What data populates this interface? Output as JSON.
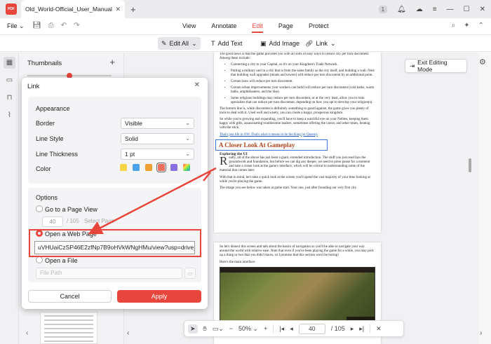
{
  "titlebar": {
    "logo_text": "PDF",
    "tab_name": "Old_World-Official_User_Manual",
    "notification_count": "1"
  },
  "menu": {
    "file": "File",
    "tabs": [
      "View",
      "Annotate",
      "Edit",
      "Page",
      "Protect"
    ],
    "active_tab": "Edit"
  },
  "toolbar": {
    "edit_all": "Edit All",
    "add_text": "Add Text",
    "add_image": "Add Image",
    "link": "Link"
  },
  "thumbnails": {
    "title": "Thumbnails",
    "zoom_fraction": 0.5
  },
  "exit_editing": "Exit Editing Mode",
  "dialog": {
    "title": "Link",
    "appearance": {
      "title": "Appearance",
      "border_label": "Border",
      "border_value": "Visible",
      "style_label": "Line Style",
      "style_value": "Solid",
      "thickness_label": "Line Thickness",
      "thickness_value": "1 pt",
      "color_label": "Color",
      "colors": [
        "#f5d547",
        "#4aa3e8",
        "#f0a030",
        "#f07060",
        "#8a6fe0",
        "rainbow"
      ],
      "selected_color": "#f07060"
    },
    "options": {
      "title": "Options",
      "goto_label": "Go to a Page View",
      "goto_page": "40",
      "goto_total": "/ 105",
      "select_page": "Select Page",
      "web_label": "Open a Web Page",
      "web_url": "uVHUaiCzSP46E2zfNp7B9oHVkWNgHMu/view?usp=drive_link",
      "file_label": "Open a File",
      "file_placeholder": "File Path",
      "selected_option": "Open a Web Page"
    },
    "cancel": "Cancel",
    "apply": "Apply"
  },
  "document": {
    "p1_intro": "The good news is that the game provides you with all sorts of easy ways to reduce city per turn discontent.  Among these include:",
    "bullets": [
      "Connecting a city to your Capital, so it's on your Kingdom's Trade Network.",
      "Putting a military unit in a city that is from the same family as the city itself, and building a wall.  Note that building wall upgrades (moats and towers) will reduce per turn discontent by an additional point.",
      "Certain laws will reduce per turn discontent.",
      "Certain urban improvements your workers can build will reduce per turn discontent (cold baths, warm baths, amphitheaters, and the like).",
      "Some religious buildings may reduce per turn discontent, or at the very least, allow you to train specialists that can reduce per turn discontent, depending on how you opt to develop your religion(s)."
    ],
    "p_bottom_line": "The bottom line is, while discontent is definitely something to guard against, the game gives you plenty of tools to deal with it.  Used well and wisely, you can create a happy, prosperous kingdom.",
    "p_growing": "So while you're growing and expanding, you'll have to keep a watchful eye on your Nobles, keeping them happy with gifts, assassinating troublesome leaders, sometimes offering the carrot, and other times, beating with the stick.",
    "link_line": "That's just life in OW.  That's what it means to be the King (or Queen).",
    "heading": "A Closer Look At Gameplay",
    "subhead": "Exploring the UI",
    "drop_cap": "R",
    "p_really": "eally, all of the above has just been a giant, extended introduction.  The stuff you just read lays the groundwork and foundation, but before we can dig any deeper, we need to press pause for a moment and take a closer look at the game's interface, which will be critical to understanding some of the material that comes later.",
    "p_intel": "With that in mind, let's take a quick look at the screen you'll spend the vast majority of your time looking at while you're playing the game.",
    "p_image": "The image you see below was taken at game start.  Your one, just after founding our very first city.",
    "p2_intro": "So let's dissect this screen and talk about the basics of navigation so you'll be able to navigate your way around the world with relative ease.  Note that even if you've been playing the game for a while, you may pick up a thing or two that you didn't know, so I promise that this section won't be boring!",
    "p2_main": "Here's the main interface:"
  },
  "pagebar": {
    "zoom": "50%",
    "current_page": "40",
    "total": "/ 105"
  },
  "colors": {
    "accent": "#e8453c",
    "link": "#1a55b3",
    "heading": "#b1441f"
  }
}
